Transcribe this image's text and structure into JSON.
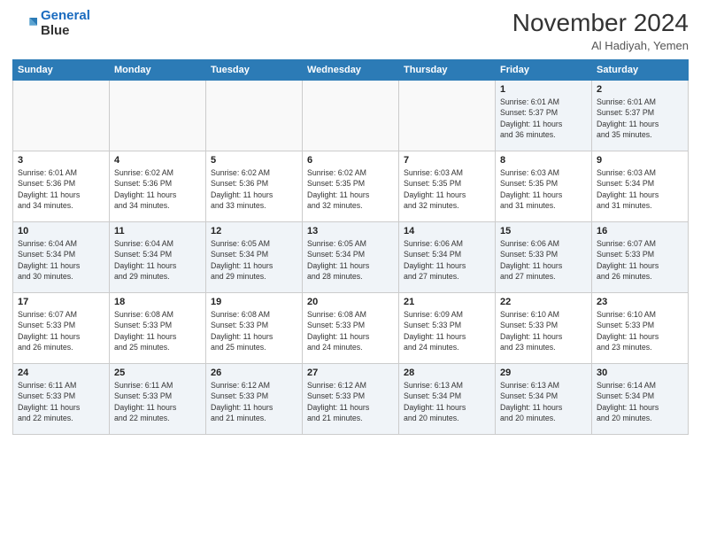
{
  "header": {
    "logo_line1": "General",
    "logo_line2": "Blue",
    "month": "November 2024",
    "location": "Al Hadiyah, Yemen"
  },
  "days_of_week": [
    "Sunday",
    "Monday",
    "Tuesday",
    "Wednesday",
    "Thursday",
    "Friday",
    "Saturday"
  ],
  "weeks": [
    [
      {
        "day": "",
        "info": ""
      },
      {
        "day": "",
        "info": ""
      },
      {
        "day": "",
        "info": ""
      },
      {
        "day": "",
        "info": ""
      },
      {
        "day": "",
        "info": ""
      },
      {
        "day": "1",
        "info": "Sunrise: 6:01 AM\nSunset: 5:37 PM\nDaylight: 11 hours\nand 36 minutes."
      },
      {
        "day": "2",
        "info": "Sunrise: 6:01 AM\nSunset: 5:37 PM\nDaylight: 11 hours\nand 35 minutes."
      }
    ],
    [
      {
        "day": "3",
        "info": "Sunrise: 6:01 AM\nSunset: 5:36 PM\nDaylight: 11 hours\nand 34 minutes."
      },
      {
        "day": "4",
        "info": "Sunrise: 6:02 AM\nSunset: 5:36 PM\nDaylight: 11 hours\nand 34 minutes."
      },
      {
        "day": "5",
        "info": "Sunrise: 6:02 AM\nSunset: 5:36 PM\nDaylight: 11 hours\nand 33 minutes."
      },
      {
        "day": "6",
        "info": "Sunrise: 6:02 AM\nSunset: 5:35 PM\nDaylight: 11 hours\nand 32 minutes."
      },
      {
        "day": "7",
        "info": "Sunrise: 6:03 AM\nSunset: 5:35 PM\nDaylight: 11 hours\nand 32 minutes."
      },
      {
        "day": "8",
        "info": "Sunrise: 6:03 AM\nSunset: 5:35 PM\nDaylight: 11 hours\nand 31 minutes."
      },
      {
        "day": "9",
        "info": "Sunrise: 6:03 AM\nSunset: 5:34 PM\nDaylight: 11 hours\nand 31 minutes."
      }
    ],
    [
      {
        "day": "10",
        "info": "Sunrise: 6:04 AM\nSunset: 5:34 PM\nDaylight: 11 hours\nand 30 minutes."
      },
      {
        "day": "11",
        "info": "Sunrise: 6:04 AM\nSunset: 5:34 PM\nDaylight: 11 hours\nand 29 minutes."
      },
      {
        "day": "12",
        "info": "Sunrise: 6:05 AM\nSunset: 5:34 PM\nDaylight: 11 hours\nand 29 minutes."
      },
      {
        "day": "13",
        "info": "Sunrise: 6:05 AM\nSunset: 5:34 PM\nDaylight: 11 hours\nand 28 minutes."
      },
      {
        "day": "14",
        "info": "Sunrise: 6:06 AM\nSunset: 5:34 PM\nDaylight: 11 hours\nand 27 minutes."
      },
      {
        "day": "15",
        "info": "Sunrise: 6:06 AM\nSunset: 5:33 PM\nDaylight: 11 hours\nand 27 minutes."
      },
      {
        "day": "16",
        "info": "Sunrise: 6:07 AM\nSunset: 5:33 PM\nDaylight: 11 hours\nand 26 minutes."
      }
    ],
    [
      {
        "day": "17",
        "info": "Sunrise: 6:07 AM\nSunset: 5:33 PM\nDaylight: 11 hours\nand 26 minutes."
      },
      {
        "day": "18",
        "info": "Sunrise: 6:08 AM\nSunset: 5:33 PM\nDaylight: 11 hours\nand 25 minutes."
      },
      {
        "day": "19",
        "info": "Sunrise: 6:08 AM\nSunset: 5:33 PM\nDaylight: 11 hours\nand 25 minutes."
      },
      {
        "day": "20",
        "info": "Sunrise: 6:08 AM\nSunset: 5:33 PM\nDaylight: 11 hours\nand 24 minutes."
      },
      {
        "day": "21",
        "info": "Sunrise: 6:09 AM\nSunset: 5:33 PM\nDaylight: 11 hours\nand 24 minutes."
      },
      {
        "day": "22",
        "info": "Sunrise: 6:10 AM\nSunset: 5:33 PM\nDaylight: 11 hours\nand 23 minutes."
      },
      {
        "day": "23",
        "info": "Sunrise: 6:10 AM\nSunset: 5:33 PM\nDaylight: 11 hours\nand 23 minutes."
      }
    ],
    [
      {
        "day": "24",
        "info": "Sunrise: 6:11 AM\nSunset: 5:33 PM\nDaylight: 11 hours\nand 22 minutes."
      },
      {
        "day": "25",
        "info": "Sunrise: 6:11 AM\nSunset: 5:33 PM\nDaylight: 11 hours\nand 22 minutes."
      },
      {
        "day": "26",
        "info": "Sunrise: 6:12 AM\nSunset: 5:33 PM\nDaylight: 11 hours\nand 21 minutes."
      },
      {
        "day": "27",
        "info": "Sunrise: 6:12 AM\nSunset: 5:33 PM\nDaylight: 11 hours\nand 21 minutes."
      },
      {
        "day": "28",
        "info": "Sunrise: 6:13 AM\nSunset: 5:34 PM\nDaylight: 11 hours\nand 20 minutes."
      },
      {
        "day": "29",
        "info": "Sunrise: 6:13 AM\nSunset: 5:34 PM\nDaylight: 11 hours\nand 20 minutes."
      },
      {
        "day": "30",
        "info": "Sunrise: 6:14 AM\nSunset: 5:34 PM\nDaylight: 11 hours\nand 20 minutes."
      }
    ]
  ]
}
